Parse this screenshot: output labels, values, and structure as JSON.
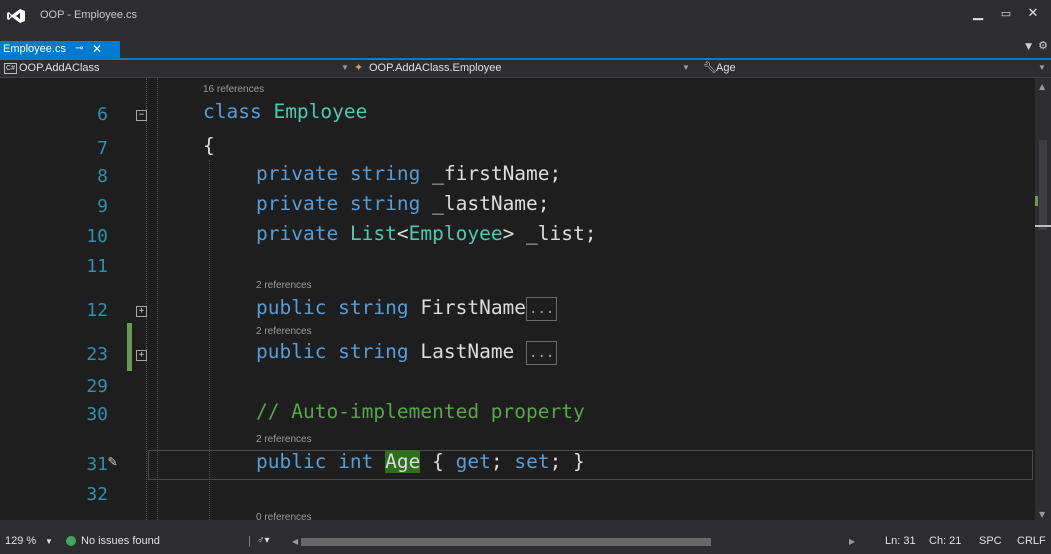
{
  "window": {
    "title": "OOP - Employee.cs"
  },
  "tab": {
    "label": "Employee.cs",
    "pin": "⊸",
    "close": "✕"
  },
  "navbar": {
    "project": "OOP.AddAClass",
    "type": "OOP.AddAClass.Employee",
    "member": "Age"
  },
  "code": {
    "references": [
      "16 references",
      "2 references",
      "2 references",
      "2 references",
      "0 references"
    ],
    "line_numbers": [
      "6",
      "7",
      "8",
      "9",
      "10",
      "11",
      "12",
      "23",
      "29",
      "30",
      "31",
      "32"
    ],
    "lines": {
      "l6_kw": "class",
      "l6_type": "Employee",
      "l7": "{",
      "l8_kw": "private string",
      "l8_rest": "_firstName;",
      "l9_kw": "private string",
      "l9_rest": "_lastName;",
      "l10_kw": "private",
      "l10_type1": "List",
      "l10_lt": "<",
      "l10_type2": "Employee",
      "l10_rest": "> _list;",
      "l12_kw": "public string",
      "l12_rest": "FirstName",
      "l23_kw": "public string",
      "l23_rest": "LastName ",
      "l30_comment": "// Auto-implemented property",
      "l31_kw1": "public int",
      "l31_hl": "Age",
      "l31_a": " { ",
      "l31_kw2": "get",
      "l31_b": "; ",
      "l31_kw3": "set",
      "l31_c": "; }",
      "ellipsis": "..."
    }
  },
  "status": {
    "zoom": "129 %",
    "issues": "No issues found",
    "line": "Ln: 31",
    "col": "Ch: 21",
    "spc": "SPC",
    "crlf": "CRLF"
  },
  "colors": {
    "accent": "#007acc",
    "keyword": "#569cd6",
    "type": "#4ec9b0",
    "comment": "#57a64a",
    "linenumber": "#2b91af"
  }
}
